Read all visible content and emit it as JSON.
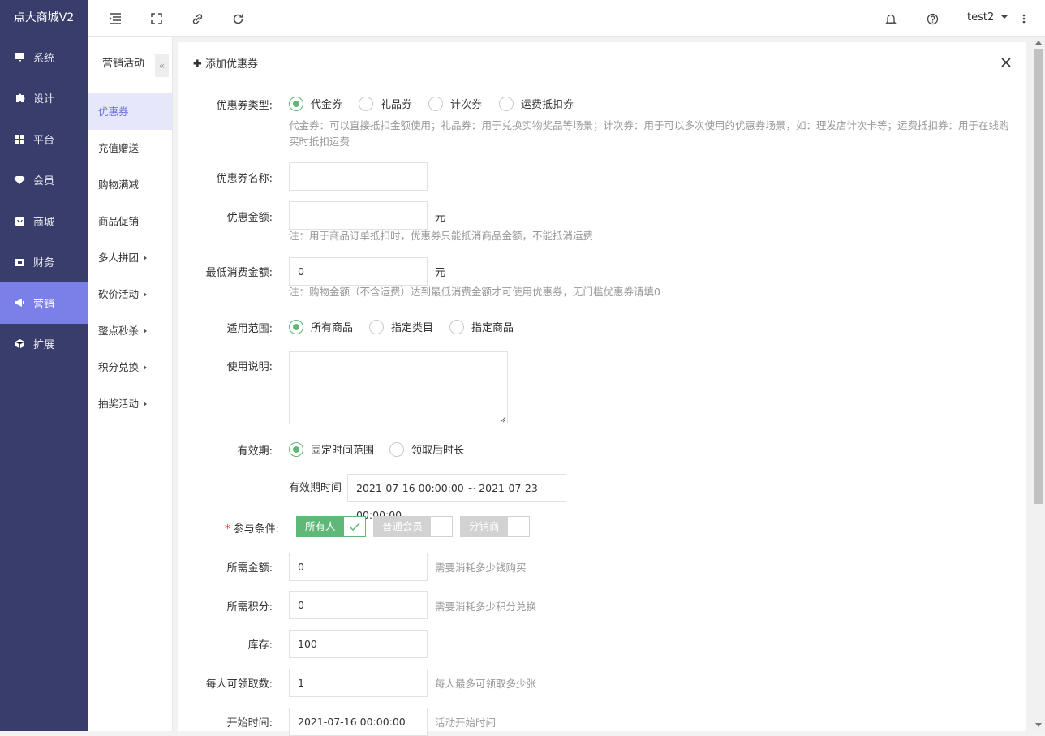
{
  "app": {
    "title": "点大商城V2"
  },
  "nav": [
    {
      "label": "系统",
      "icon": "monitor-icon"
    },
    {
      "label": "设计",
      "icon": "puzzle-icon"
    },
    {
      "label": "平台",
      "icon": "grid-icon"
    },
    {
      "label": "会员",
      "icon": "diamond-icon"
    },
    {
      "label": "商城",
      "icon": "bag-icon"
    },
    {
      "label": "财务",
      "icon": "wallet-icon"
    },
    {
      "label": "营销",
      "icon": "megaphone-icon",
      "active": true
    },
    {
      "label": "扩展",
      "icon": "cube-icon"
    }
  ],
  "topbar": {
    "user": "test2",
    "icons": [
      "menu-toggle-icon",
      "fullscreen-icon",
      "link-icon",
      "refresh-icon",
      "bell-icon",
      "help-icon",
      "more-icon"
    ]
  },
  "sub": {
    "title": "营销活动",
    "collapse": "«",
    "items": [
      {
        "label": "优惠券",
        "active": true
      },
      {
        "label": "充值赠送"
      },
      {
        "label": "购物满减"
      },
      {
        "label": "商品促销"
      },
      {
        "label": "多人拼团",
        "caret": true
      },
      {
        "label": "砍价活动",
        "caret": true
      },
      {
        "label": "整点秒杀",
        "caret": true
      },
      {
        "label": "积分兑换",
        "caret": true
      },
      {
        "label": "抽奖活动",
        "caret": true
      }
    ]
  },
  "form": {
    "title": "添加优惠券",
    "type_label": "优惠券类型:",
    "type_options": [
      "代金券",
      "礼品券",
      "计次券",
      "运费抵扣券"
    ],
    "type_note": "代金券：可以直接抵扣金额使用；礼品券：用于兑换实物奖品等场景；计次券：用于可以多次使用的优惠券场景，如：理发店计次卡等；运费抵扣券：用于在线购买时抵扣运费",
    "name_label": "优惠券名称:",
    "amount_label": "优惠金额:",
    "amount_unit": "元",
    "amount_note": "注：用于商品订单抵扣时，优惠券只能抵消商品金额，不能抵消运费",
    "min_label": "最低消费金额:",
    "min_value": "0",
    "min_unit": "元",
    "min_note": "注：购物金额（不含运费）达到最低消费金额才可使用优惠券，无门槛优惠券请填0",
    "scope_label": "适用范围:",
    "scope_options": [
      "所有商品",
      "指定类目",
      "指定商品"
    ],
    "desc_label": "使用说明:",
    "valid_label": "有效期:",
    "valid_options": [
      "固定时间范围",
      "领取后时长"
    ],
    "valid_time_label": "有效期时间",
    "valid_time_value": "2021-07-16 00:00:00 ~ 2021-07-23 00:00:00",
    "cond_required": "*",
    "cond_label": "参与条件:",
    "cond_options": [
      "所有人",
      "普通会员",
      "分销商"
    ],
    "price_label": "所需金额:",
    "price_value": "0",
    "price_hint": "需要消耗多少钱购买",
    "score_label": "所需积分:",
    "score_value": "0",
    "score_hint": "需要消耗多少积分兑换",
    "stock_label": "库存:",
    "stock_value": "100",
    "per_label": "每人可领取数:",
    "per_value": "1",
    "per_hint": "每人最多可领取多少张",
    "start_label": "开始时间:",
    "start_value": "2021-07-16 00:00:00",
    "start_hint": "活动开始时间"
  }
}
